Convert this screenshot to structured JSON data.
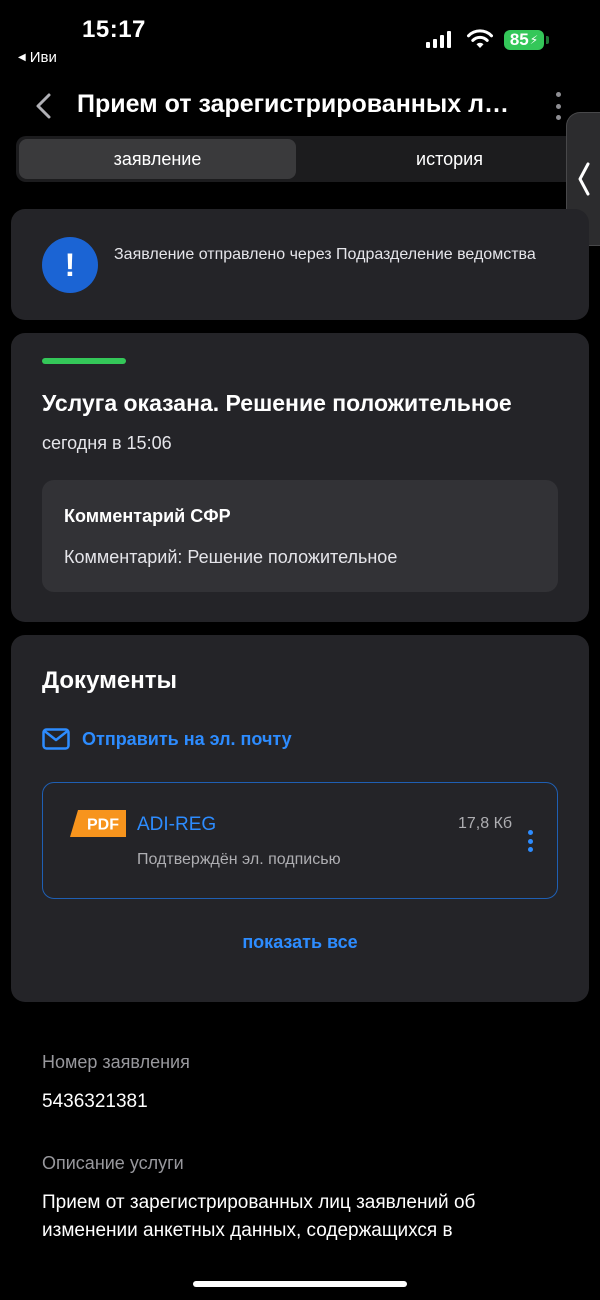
{
  "status_bar": {
    "time": "15:17",
    "back_app": "Иви",
    "battery": "85"
  },
  "header": {
    "title": "Прием от зарегистрированных лиц заявлений об изменении анкетных данных"
  },
  "tabs": [
    {
      "label": "заявление",
      "active": true
    },
    {
      "label": "история",
      "active": false
    }
  ],
  "notice": {
    "icon": "exclamation-icon",
    "text": "Заявление отправлено через Подразделение ведомства"
  },
  "status": {
    "accent_color": "#34c759",
    "title": "Услуга оказана. Решение положительное",
    "time": "сегодня в 15:06",
    "comment_title": "Комментарий СФР",
    "comment_text": "Комментарий: Решение положительное"
  },
  "documents": {
    "title": "Документы",
    "send_email": "Отправить на эл. почту",
    "items": [
      {
        "badge": "PDF",
        "name": "ADI-REG",
        "size": "17,8 Кб",
        "signed": "Подтверждён эл. подписью"
      }
    ],
    "show_all": "показать все"
  },
  "application": {
    "number_label": "Номер заявления",
    "number": "5436321381",
    "description_label": "Описание услуги",
    "description": "Прием от зарегистрированных лиц заявлений об изменении анкетных данных, содержащихся в"
  },
  "colors": {
    "accent_blue": "#2d8cff",
    "pdf_orange": "#f7941d",
    "battery_green": "#34c759"
  }
}
